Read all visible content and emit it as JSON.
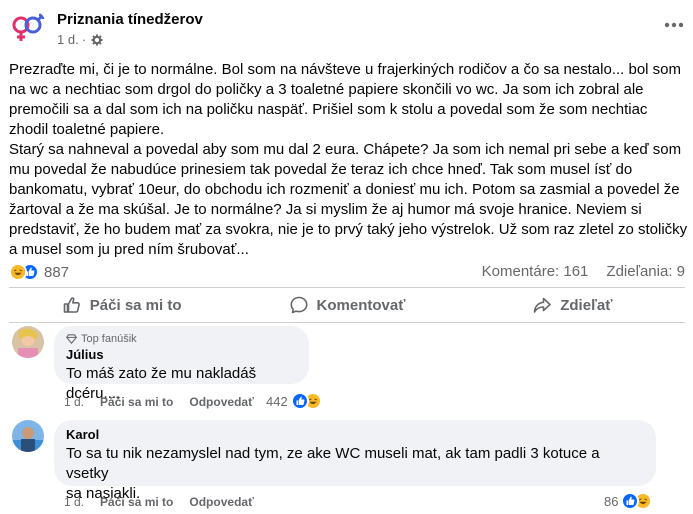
{
  "post": {
    "page_name": "Priznania tínedžerov",
    "time": "1 d.",
    "dot": "·",
    "more_icon": "more-horizontal-icon",
    "paragraphs": [
      "Prezraďte mi, či je to normálne. Bol som na návšteve u frajerkiných rodičov a čo sa nestalo... bol som na wc a nechtiac som drgol do poličky a 3 toaletné papiere skončili vo wc. Ja som ich zobral ale premočili sa a dal som ich na poličku naspäť. Prišiel som k stolu a povedal som že som nechtiac zhodil toaletné papiere.",
      "Starý sa nahneval a povedal aby som mu dal 2 eura. Chápete? Ja som ich nemal pri sebe a keď som mu povedal že nabudúce prinesiem tak povedal že teraz ich chce hneď. Tak som musel ísť do bankomatu, vybrať 10eur, do obchodu ich rozmeniť a doniesť mu ich. Potom sa zasmial a povedel že žartoval a že ma skúšal. Je to normálne? Ja si myslim že aj humor má svoje hranice. Neviem si predstaviť, že ho budem mať za svokra, nie je to prvý taký jeho výstrelok. Už som raz zletel zo stoličky a musel som ju pred ním šrubovať..."
    ],
    "reaction_count": "887",
    "comments_count": "Komentáre: 161",
    "shares_count": "Zdieľania: 9"
  },
  "actions": {
    "like": "Páči sa mi to",
    "comment": "Komentovať",
    "share": "Zdieľať"
  },
  "comments": [
    {
      "badge": "Top fanúšik",
      "author": "Július",
      "text": "To máš zato že mu nakladáš dcéru....",
      "time": "1 d.",
      "like": "Páči sa mi to",
      "reply": "Odpovedať",
      "reactions": "442"
    },
    {
      "author": "Karol",
      "text_lines": [
        "To sa tu nik nezamyslel nad tym, ze ake WC museli mat, ak tam padli 3 kotuce a vsetky",
        "sa nasiakli."
      ],
      "time": "1 d.",
      "like": "Páči sa mi to",
      "reply": "Odpovedať",
      "reactions": "86"
    }
  ],
  "colors": {
    "like_blue": "#0866ff",
    "haha_yellow": "#f7b928",
    "muted_text": "#65676b",
    "bubble_bg": "#f0f2f5"
  }
}
